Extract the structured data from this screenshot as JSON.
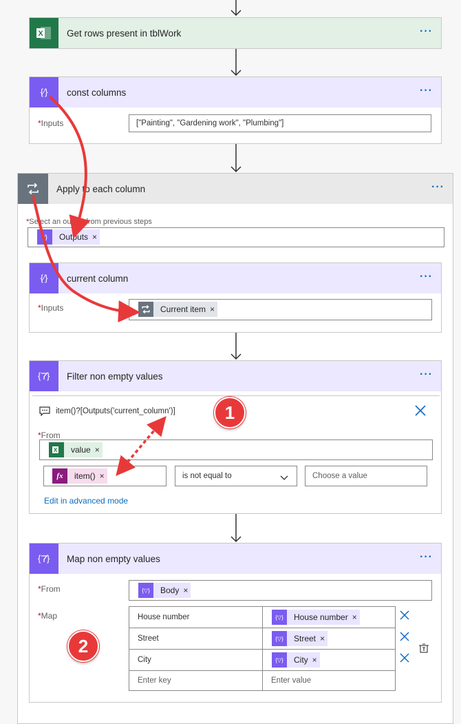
{
  "steps": {
    "get_rows": {
      "title": "Get rows present in tblWork",
      "more": "···"
    },
    "const_columns": {
      "title": "const columns",
      "more": "···",
      "inputs_label": "Inputs",
      "inputs_value": "[\"Painting\", \"Gardening work\", \"Plumbing\"]"
    },
    "apply_each": {
      "title": "Apply to each column",
      "more": "···",
      "select_label": "Select an output from previous steps",
      "token": "Outputs"
    },
    "current_column": {
      "title": "current column",
      "more": "···",
      "inputs_label": "Inputs",
      "token": "Current item"
    },
    "filter": {
      "title": "Filter non empty values",
      "more": "···",
      "expression": "item()?[Outputs('current_column')]",
      "from_label": "From",
      "from_token": "value",
      "left_token": "item()",
      "operator": "is not equal to",
      "right_placeholder": "Choose a value",
      "advanced_link": "Edit in advanced mode"
    },
    "map": {
      "title": "Map non empty values",
      "more": "···",
      "from_label": "From",
      "from_token": "Body",
      "map_label": "Map",
      "rows": [
        {
          "key": "House number",
          "value": "House number"
        },
        {
          "key": "Street",
          "value": "Street"
        },
        {
          "key": "City",
          "value": "City"
        }
      ],
      "key_placeholder": "Enter key",
      "value_placeholder": "Enter value"
    }
  },
  "annotations": {
    "badge1": "1",
    "badge2": "2"
  },
  "required_mark": "*",
  "remove_mark": "×",
  "colors": {
    "excel_green": "#21794a",
    "data_op_purple": "#7b5cf0",
    "control_gray": "#69737d",
    "annotation_red": "#e8393a",
    "link_blue": "#0f6cbd"
  }
}
